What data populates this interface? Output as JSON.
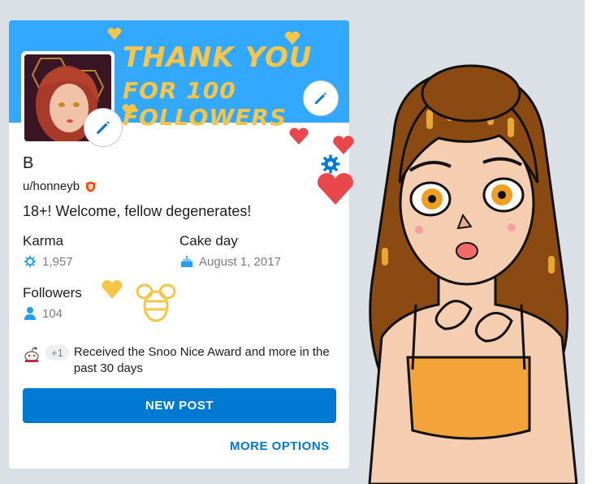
{
  "banner": {
    "line1": "THANK YOU",
    "line2": "FOR 100 FOLLOWERS"
  },
  "profile": {
    "display_name": "B",
    "username": "u/honneyb",
    "description": "18+! Welcome, fellow degenerates!"
  },
  "stats": {
    "karma_label": "Karma",
    "karma_value": "1,957",
    "cakeday_label": "Cake day",
    "cakeday_value": "August 1, 2017",
    "followers_label": "Followers",
    "followers_value": "104"
  },
  "awards": {
    "extra_count": "+1",
    "text": "Received the Snoo Nice Award and more in the past 30 days"
  },
  "actions": {
    "new_post": "NEW POST",
    "more_options": "MORE OPTIONS"
  },
  "colors": {
    "banner": "#33a8ff",
    "accent": "#0079d3",
    "page_bg": "#dae0e6"
  }
}
